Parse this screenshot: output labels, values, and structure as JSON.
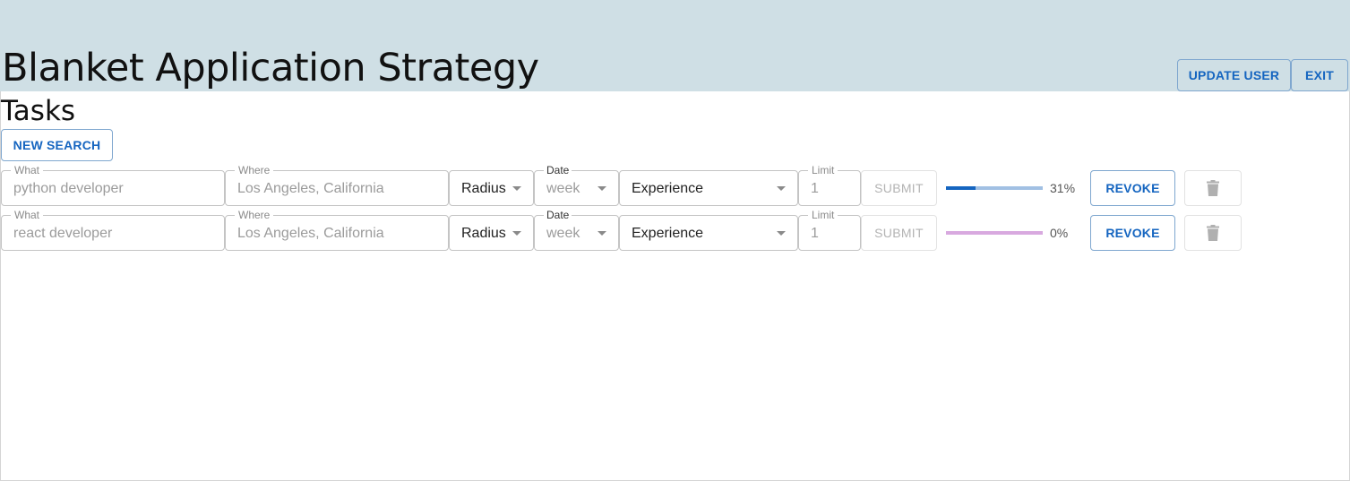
{
  "header": {
    "title": "Blanket Application Strategy",
    "update_user_label": "UPDATE USER",
    "exit_label": "EXIT"
  },
  "section": {
    "title": "Tasks",
    "new_search_label": "NEW SEARCH"
  },
  "task_labels": {
    "what": "What",
    "where": "Where",
    "radius": "Radius",
    "date": "Date",
    "experience": "Experience",
    "limit": "Limit",
    "submit": "SUBMIT",
    "revoke": "REVOKE"
  },
  "tasks": [
    {
      "what": "python developer",
      "where": "Los Angeles, California",
      "date": "week",
      "limit": "1",
      "progress_label": "31%",
      "progress": 0.31,
      "bar_color": "#1565c0",
      "bar_track_color": "#a1c0e3"
    },
    {
      "what": "react developer",
      "where": "Los Angeles, California",
      "date": "week",
      "limit": "1",
      "progress_label": "0%",
      "progress": 0,
      "bar_color": "#9c27b0",
      "bar_track_color": "#d8a9df"
    }
  ]
}
